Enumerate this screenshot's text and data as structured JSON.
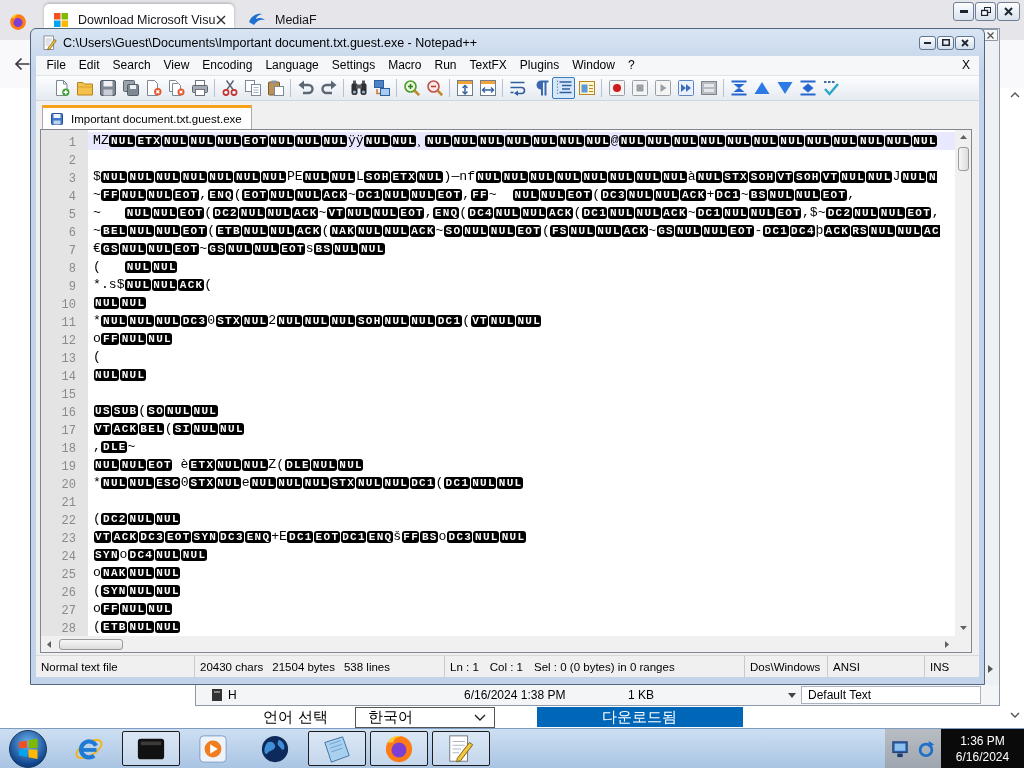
{
  "browser": {
    "tabs": [
      {
        "title": "Download Microsoft Visu",
        "selected": true
      },
      {
        "title": "MediaF",
        "selected": false
      }
    ]
  },
  "window": {
    "title": "C:\\Users\\Guest\\Documents\\Important document.txt.guest.exe - Notepad++"
  },
  "menu": {
    "items": [
      "File",
      "Edit",
      "Search",
      "View",
      "Encoding",
      "Language",
      "Settings",
      "Macro",
      "Run",
      "TextFX",
      "Plugins",
      "Window",
      "?"
    ],
    "close": "X"
  },
  "toolbar": {
    "buttons": [
      {
        "on": false
      },
      {
        "on": false
      },
      {
        "on": false
      },
      {
        "on": false
      },
      {
        "on": false
      },
      {
        "on": false
      },
      {
        "on": false
      },
      {
        "on": false
      },
      {
        "on": false
      },
      {
        "on": false
      },
      {
        "on": false
      },
      {
        "on": false
      },
      {
        "on": false
      },
      {
        "on": false
      },
      {
        "on": false
      },
      {
        "on": false
      },
      {
        "on": false
      },
      {
        "on": false
      },
      {
        "on": false
      },
      {
        "on": false
      },
      {
        "on": true
      },
      {
        "on": false
      },
      {
        "on": false
      },
      {
        "on": false
      },
      {
        "on": false
      },
      {
        "on": false
      },
      {
        "on": false
      },
      {
        "on": false
      },
      {
        "on": false
      },
      {
        "on": false
      },
      {
        "on": false
      },
      {
        "on": false
      }
    ]
  },
  "tabs": [
    {
      "title": "Important document.txt.guest.exe",
      "selected": true
    }
  ],
  "editor": {
    "lines": [
      {
        "number": "1",
        "current": true,
        "segments": [
          {
            "kind": "text",
            "text": "MZ"
          },
          {
            "kind": "ctrl",
            "codes": [
              "NUL",
              "ETX",
              "NUL",
              "NUL",
              "NUL",
              "EOT",
              "NUL",
              "NUL",
              "NUL"
            ]
          },
          {
            "kind": "text",
            "text": "ÿÿ"
          },
          {
            "kind": "ctrl",
            "codes": [
              "NUL",
              "NUL"
            ]
          },
          {
            "kind": "text",
            "text": "¸"
          },
          {
            "kind": "ctrl",
            "codes": [
              "NUL",
              "NUL",
              "NUL",
              "NUL",
              "NUL",
              "NUL",
              "NUL"
            ]
          },
          {
            "kind": "text",
            "text": "@"
          },
          {
            "kind": "ctrl",
            "codes": [
              "NUL",
              "NUL",
              "NUL",
              "NUL",
              "NUL",
              "NUL",
              "NUL",
              "NUL",
              "NUL",
              "NUL",
              "NUL",
              "NUL"
            ]
          }
        ]
      },
      {
        "number": "2",
        "current": false
      },
      {
        "number": "3",
        "current": false,
        "segments": [
          {
            "kind": "text",
            "text": "$"
          },
          {
            "kind": "ctrl",
            "codes": [
              "NUL",
              "NUL",
              "NUL",
              "NUL",
              "NUL",
              "NUL",
              "NUL"
            ]
          },
          {
            "kind": "text",
            "text": "PE"
          },
          {
            "kind": "ctrl",
            "codes": [
              "NUL",
              "NUL"
            ]
          },
          {
            "kind": "text",
            "text": "L"
          },
          {
            "kind": "ctrl",
            "codes": [
              "SOH",
              "ETX",
              "NUL"
            ]
          },
          {
            "kind": "text",
            "text": ")—nf"
          },
          {
            "kind": "ctrl",
            "codes": [
              "NUL",
              "NUL",
              "NUL",
              "NUL",
              "NUL",
              "NUL",
              "NUL",
              "NUL"
            ]
          },
          {
            "kind": "text",
            "text": "à"
          },
          {
            "kind": "ctrl",
            "codes": [
              "NUL",
              "STX",
              "SOH",
              "VT",
              "SOH",
              "VT",
              "NUL",
              "NUL"
            ]
          },
          {
            "kind": "text",
            "text": "J"
          },
          {
            "kind": "ctrl",
            "codes": [
              "NUL"
            ]
          },
          {
            "kind": "ctrl_cut",
            "codes": [
              "N"
            ]
          }
        ]
      },
      {
        "number": "4",
        "current": false,
        "segments": [
          {
            "kind": "text",
            "text": "~"
          },
          {
            "kind": "ctrl",
            "codes": [
              "FF",
              "NUL",
              "NUL",
              "EOT"
            ]
          },
          {
            "kind": "text",
            "text": ","
          },
          {
            "kind": "ctrl",
            "codes": [
              "ENQ"
            ]
          },
          {
            "kind": "text",
            "text": "("
          },
          {
            "kind": "ctrl",
            "codes": [
              "EOT",
              "NUL",
              "NUL",
              "ACK"
            ]
          },
          {
            "kind": "text",
            "text": "~"
          },
          {
            "kind": "ctrl",
            "codes": [
              "DC1",
              "NUL",
              "NUL",
              "EOT"
            ]
          },
          {
            "kind": "text",
            "text": ","
          },
          {
            "kind": "ctrl",
            "codes": [
              "FF"
            ]
          },
          {
            "kind": "text",
            "text": "~  "
          },
          {
            "kind": "ctrl",
            "codes": [
              "NUL",
              "NUL",
              "EOT"
            ]
          },
          {
            "kind": "text",
            "text": "("
          },
          {
            "kind": "ctrl",
            "codes": [
              "DC3",
              "NUL",
              "NUL",
              "ACK"
            ]
          },
          {
            "kind": "text",
            "text": "+"
          },
          {
            "kind": "ctrl",
            "codes": [
              "DC1"
            ]
          },
          {
            "kind": "text",
            "text": "~"
          },
          {
            "kind": "ctrl",
            "codes": [
              "BS",
              "NUL",
              "NUL",
              "EOT"
            ]
          },
          {
            "kind": "text",
            "text": ","
          }
        ]
      },
      {
        "number": "5",
        "current": false,
        "segments": [
          {
            "kind": "text",
            "text": "~   "
          },
          {
            "kind": "ctrl",
            "codes": [
              "NUL",
              "NUL",
              "EOT"
            ]
          },
          {
            "kind": "text",
            "text": "("
          },
          {
            "kind": "ctrl",
            "codes": [
              "DC2",
              "NUL",
              "NUL",
              "ACK"
            ]
          },
          {
            "kind": "text",
            "text": "~"
          },
          {
            "kind": "ctrl",
            "codes": [
              "VT",
              "NUL",
              "NUL",
              "EOT"
            ]
          },
          {
            "kind": "text",
            "text": ","
          },
          {
            "kind": "ctrl",
            "codes": [
              "ENQ"
            ]
          },
          {
            "kind": "text",
            "text": "("
          },
          {
            "kind": "ctrl",
            "codes": [
              "DC4",
              "NUL",
              "NUL",
              "ACK"
            ]
          },
          {
            "kind": "text",
            "text": "("
          },
          {
            "kind": "ctrl",
            "codes": [
              "DC1",
              "NUL",
              "NUL",
              "ACK"
            ]
          },
          {
            "kind": "text",
            "text": "~"
          },
          {
            "kind": "ctrl",
            "codes": [
              "DC1",
              "NUL",
              "NUL",
              "EOT"
            ]
          },
          {
            "kind": "text",
            "text": ",$~"
          },
          {
            "kind": "ctrl",
            "codes": [
              "DC2",
              "NUL",
              "NUL",
              "EOT"
            ]
          },
          {
            "kind": "text",
            "text": ","
          }
        ]
      },
      {
        "number": "6",
        "current": false,
        "segments": [
          {
            "kind": "text",
            "text": "~"
          },
          {
            "kind": "ctrl",
            "codes": [
              "BEL",
              "NUL",
              "NUL",
              "EOT"
            ]
          },
          {
            "kind": "text",
            "text": "("
          },
          {
            "kind": "ctrl",
            "codes": [
              "ETB",
              "NUL",
              "NUL",
              "ACK"
            ]
          },
          {
            "kind": "text",
            "text": "("
          },
          {
            "kind": "ctrl",
            "codes": [
              "NAK",
              "NUL",
              "NUL",
              "ACK"
            ]
          },
          {
            "kind": "text",
            "text": "~"
          },
          {
            "kind": "ctrl",
            "codes": [
              "SO",
              "NUL",
              "NUL",
              "EOT"
            ]
          },
          {
            "kind": "text",
            "text": "("
          },
          {
            "kind": "ctrl",
            "codes": [
              "FS",
              "NUL",
              "NUL",
              "ACK"
            ]
          },
          {
            "kind": "text",
            "text": "~"
          },
          {
            "kind": "ctrl",
            "codes": [
              "GS",
              "NUL",
              "NUL",
              "EOT"
            ]
          },
          {
            "kind": "text",
            "text": "-"
          },
          {
            "kind": "ctrl",
            "codes": [
              "DC1",
              "DC4"
            ]
          },
          {
            "kind": "text",
            "text": "þ"
          },
          {
            "kind": "ctrl",
            "codes": [
              "ACK",
              "RS",
              "NUL",
              "NUL"
            ]
          },
          {
            "kind": "ctrl_cut",
            "codes": [
              "AC"
            ]
          }
        ]
      },
      {
        "number": "7",
        "current": false,
        "segments": [
          {
            "kind": "text",
            "text": "€"
          },
          {
            "kind": "ctrl",
            "codes": [
              "GS",
              "NUL",
              "NUL",
              "EOT"
            ]
          },
          {
            "kind": "text",
            "text": "~"
          },
          {
            "kind": "ctrl",
            "codes": [
              "GS",
              "NUL",
              "NUL",
              "EOT"
            ]
          },
          {
            "kind": "text",
            "text": "s"
          },
          {
            "kind": "ctrl",
            "codes": [
              "BS",
              "NUL",
              "NUL"
            ]
          }
        ]
      },
      {
        "number": "8",
        "current": false,
        "segments": [
          {
            "kind": "text",
            "text": "(   "
          },
          {
            "kind": "ctrl",
            "codes": [
              "NUL",
              "NUL"
            ]
          }
        ]
      },
      {
        "number": "9",
        "current": false,
        "segments": [
          {
            "kind": "text",
            "text": "*.s$"
          },
          {
            "kind": "ctrl",
            "codes": [
              "NUL",
              "NUL",
              "ACK"
            ]
          },
          {
            "kind": "text",
            "text": "("
          }
        ]
      },
      {
        "number": "10",
        "current": false,
        "segments": [
          {
            "kind": "ctrl",
            "codes": [
              "NUL",
              "NUL"
            ]
          }
        ]
      },
      {
        "number": "11",
        "current": false,
        "segments": [
          {
            "kind": "text",
            "text": "*"
          },
          {
            "kind": "ctrl",
            "codes": [
              "NUL",
              "NUL",
              "NUL",
              "DC3"
            ]
          },
          {
            "kind": "text",
            "text": "0"
          },
          {
            "kind": "ctrl",
            "codes": [
              "STX",
              "NUL"
            ]
          },
          {
            "kind": "text",
            "text": "2"
          },
          {
            "kind": "ctrl",
            "codes": [
              "NUL",
              "NUL",
              "NUL",
              "SOH",
              "NUL",
              "NUL",
              "DC1"
            ]
          },
          {
            "kind": "text",
            "text": "("
          },
          {
            "kind": "ctrl",
            "codes": [
              "VT",
              "NUL",
              "NUL"
            ]
          }
        ]
      },
      {
        "number": "12",
        "current": false,
        "segments": [
          {
            "kind": "text",
            "text": "o"
          },
          {
            "kind": "ctrl",
            "codes": [
              "FF",
              "NUL",
              "NUL"
            ]
          }
        ]
      },
      {
        "number": "13",
        "current": false,
        "segments": [
          {
            "kind": "text",
            "text": "("
          }
        ]
      },
      {
        "number": "14",
        "current": false,
        "segments": [
          {
            "kind": "ctrl",
            "codes": [
              "NUL",
              "NUL"
            ]
          }
        ]
      },
      {
        "number": "15",
        "current": false
      },
      {
        "number": "16",
        "current": false,
        "segments": [
          {
            "kind": "ctrl",
            "codes": [
              "US",
              "SUB"
            ]
          },
          {
            "kind": "text",
            "text": "("
          },
          {
            "kind": "ctrl",
            "codes": [
              "SO",
              "NUL",
              "NUL"
            ]
          }
        ]
      },
      {
        "number": "17",
        "current": false,
        "segments": [
          {
            "kind": "ctrl",
            "codes": [
              "VT",
              "ACK",
              "BEL"
            ]
          },
          {
            "kind": "text",
            "text": "("
          },
          {
            "kind": "ctrl",
            "codes": [
              "SI",
              "NUL",
              "NUL"
            ]
          }
        ]
      },
      {
        "number": "18",
        "current": false,
        "segments": [
          {
            "kind": "text",
            "text": ","
          },
          {
            "kind": "ctrl",
            "codes": [
              "DLE"
            ]
          },
          {
            "kind": "text",
            "text": "~"
          }
        ]
      },
      {
        "number": "19",
        "current": false,
        "segments": [
          {
            "kind": "ctrl",
            "codes": [
              "NUL",
              "NUL",
              "EOT"
            ]
          },
          {
            "kind": "text",
            "text": " è"
          },
          {
            "kind": "ctrl",
            "codes": [
              "ETX",
              "NUL",
              "NUL"
            ]
          },
          {
            "kind": "text",
            "text": "Z("
          },
          {
            "kind": "ctrl",
            "codes": [
              "DLE",
              "NUL",
              "NUL"
            ]
          }
        ]
      },
      {
        "number": "20",
        "current": false,
        "segments": [
          {
            "kind": "text",
            "text": "*"
          },
          {
            "kind": "ctrl",
            "codes": [
              "NUL",
              "NUL",
              "ESC"
            ]
          },
          {
            "kind": "text",
            "text": "0"
          },
          {
            "kind": "ctrl",
            "codes": [
              "STX",
              "NUL"
            ]
          },
          {
            "kind": "text",
            "text": "e"
          },
          {
            "kind": "ctrl",
            "codes": [
              "NUL",
              "NUL",
              "NUL",
              "STX",
              "NUL",
              "NUL",
              "DC1"
            ]
          },
          {
            "kind": "text",
            "text": "("
          },
          {
            "kind": "ctrl",
            "codes": [
              "DC1",
              "NUL",
              "NUL"
            ]
          }
        ]
      },
      {
        "number": "21",
        "current": false
      },
      {
        "number": "22",
        "current": false,
        "segments": [
          {
            "kind": "text",
            "text": "("
          },
          {
            "kind": "ctrl",
            "codes": [
              "DC2",
              "NUL",
              "NUL"
            ]
          }
        ]
      },
      {
        "number": "23",
        "current": false,
        "segments": [
          {
            "kind": "ctrl",
            "codes": [
              "VT",
              "ACK",
              "DC3",
              "EOT",
              "SYN",
              "DC3",
              "ENQ"
            ]
          },
          {
            "kind": "text",
            "text": "+E"
          },
          {
            "kind": "ctrl",
            "codes": [
              "DC1",
              "EOT",
              "DC1",
              "ENQ"
            ]
          },
          {
            "kind": "text",
            "text": "š"
          },
          {
            "kind": "ctrl",
            "codes": [
              "FF",
              "BS"
            ]
          },
          {
            "kind": "text",
            "text": "o"
          },
          {
            "kind": "ctrl",
            "codes": [
              "DC3",
              "NUL",
              "NUL"
            ]
          }
        ]
      },
      {
        "number": "24",
        "current": false,
        "segments": [
          {
            "kind": "ctrl",
            "codes": [
              "SYN"
            ]
          },
          {
            "kind": "text",
            "text": "o"
          },
          {
            "kind": "ctrl",
            "codes": [
              "DC4",
              "NUL",
              "NUL"
            ]
          }
        ]
      },
      {
        "number": "25",
        "current": false,
        "segments": [
          {
            "kind": "text",
            "text": "o"
          },
          {
            "kind": "ctrl",
            "codes": [
              "NAK",
              "NUL",
              "NUL"
            ]
          }
        ]
      },
      {
        "number": "26",
        "current": false,
        "segments": [
          {
            "kind": "text",
            "text": "("
          },
          {
            "kind": "ctrl",
            "codes": [
              "SYN",
              "NUL",
              "NUL"
            ]
          }
        ]
      },
      {
        "number": "27",
        "current": false,
        "segments": [
          {
            "kind": "text",
            "text": "o"
          },
          {
            "kind": "ctrl",
            "codes": [
              "FF",
              "NUL",
              "NUL"
            ]
          }
        ]
      },
      {
        "number": "28",
        "current": false,
        "segments": [
          {
            "kind": "text",
            "text": "("
          },
          {
            "kind": "ctrl",
            "codes": [
              "ETB",
              "NUL",
              "NUL"
            ]
          }
        ]
      }
    ]
  },
  "status_bar": {
    "file_type": "Normal text file",
    "length": "20430 chars",
    "bytes": "21504 bytes",
    "lines": "538 lines",
    "line": "Ln : 1",
    "column": "Col : 1",
    "selection": "Sel : 0 (0 bytes) in 0 ranges",
    "eol": "Dos\\Windows",
    "encoding": "ANSI",
    "mode": "INS"
  },
  "behind_window": {
    "file_row": {
      "name": "H",
      "date": "6/16/2024 1:38 PM",
      "size": "1 KB"
    },
    "style_dropdown": "Default Text"
  },
  "page": {
    "language_label": "언어 선택",
    "language_select": "한국어",
    "download_button": "다운로드됨"
  },
  "taskbar": {
    "apps": [
      {
        "running": false
      },
      {
        "running": true
      },
      {
        "running": false
      },
      {
        "running": false
      },
      {
        "running": true
      },
      {
        "running": true
      },
      {
        "running": true
      }
    ],
    "clock": {
      "time": "1:36 PM",
      "date": "6/16/2024"
    }
  }
}
